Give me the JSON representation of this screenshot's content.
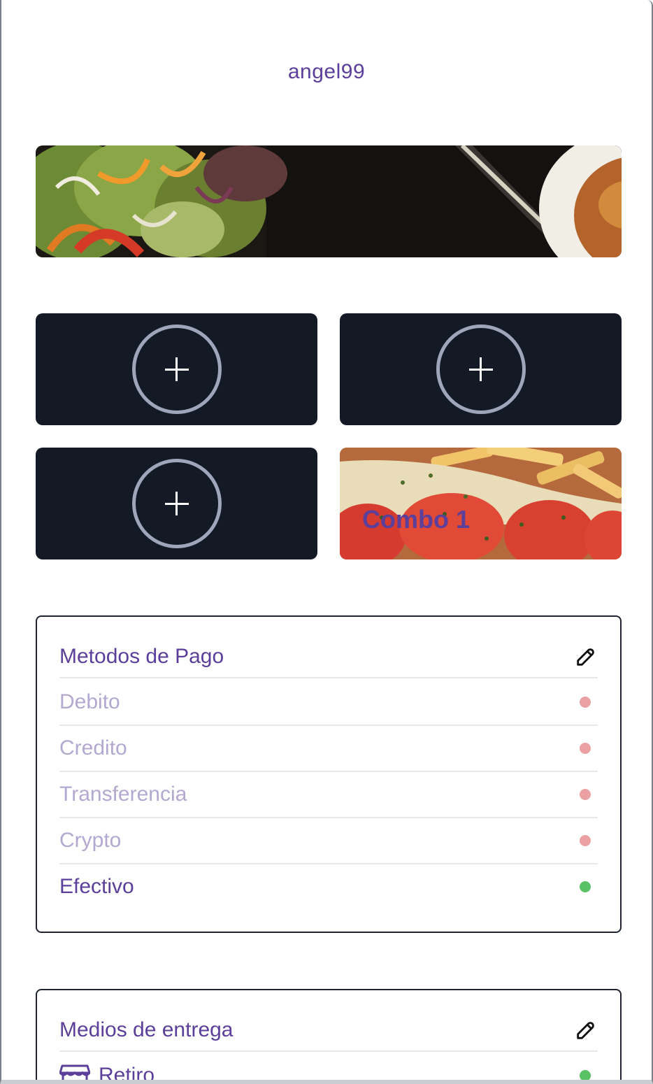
{
  "profile": {
    "username": "angel99"
  },
  "tiles": {
    "add_icon": "plus-circle-icon",
    "combo_title": "Combo 1"
  },
  "payment": {
    "title": "Metodos de Pago",
    "edit_icon": "edit-icon",
    "methods": [
      {
        "label": "Debito",
        "enabled": false
      },
      {
        "label": "Credito",
        "enabled": false
      },
      {
        "label": "Transferencia",
        "enabled": false
      },
      {
        "label": "Crypto",
        "enabled": false
      },
      {
        "label": "Efectivo",
        "enabled": true
      }
    ]
  },
  "delivery": {
    "title": "Medios de entrega",
    "edit_icon": "edit-icon",
    "methods": [
      {
        "label": "Retiro",
        "icon": "store-icon",
        "enabled": true
      }
    ]
  },
  "colors": {
    "accent": "#5b3f9a",
    "disabled_text": "#b3a8d0",
    "disabled_dot": "#eba1a1",
    "enabled_dot": "#58c264",
    "tile_bg": "#131a26"
  }
}
